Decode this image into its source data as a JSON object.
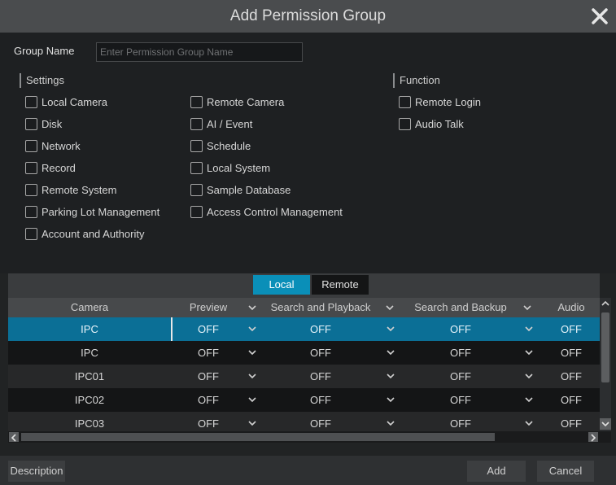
{
  "dialog": {
    "title": "Add Permission Group"
  },
  "group_name": {
    "label": "Group Name",
    "placeholder": "Enter Permission Group Name",
    "value": ""
  },
  "settings": {
    "title": "Settings",
    "col1": [
      "Local Camera",
      "Disk",
      "Network",
      "Record",
      "Remote System",
      "Parking Lot Management",
      "Account and Authority"
    ],
    "col2": [
      "Remote Camera",
      "AI / Event",
      "Schedule",
      "Local System",
      "Sample Database",
      "Access Control Management"
    ]
  },
  "function": {
    "title": "Function",
    "items": [
      "Remote Login",
      "Audio Talk"
    ]
  },
  "tabs": {
    "local": "Local",
    "remote": "Remote",
    "active": "Local"
  },
  "table": {
    "headers": [
      "Camera",
      "Preview",
      "Search and Playback",
      "Search and Backup",
      "Audio"
    ],
    "rows": [
      {
        "camera": "IPC",
        "preview": "OFF",
        "playback": "OFF",
        "backup": "OFF",
        "audio": "OFF",
        "selected": true
      },
      {
        "camera": "IPC",
        "preview": "OFF",
        "playback": "OFF",
        "backup": "OFF",
        "audio": "OFF"
      },
      {
        "camera": "IPC01",
        "preview": "OFF",
        "playback": "OFF",
        "backup": "OFF",
        "audio": "OFF"
      },
      {
        "camera": "IPC02",
        "preview": "OFF",
        "playback": "OFF",
        "backup": "OFF",
        "audio": "OFF"
      },
      {
        "camera": "IPC03",
        "preview": "OFF",
        "playback": "OFF",
        "backup": "OFF",
        "audio": "OFF"
      }
    ]
  },
  "buttons": {
    "description": "Description",
    "add": "Add",
    "cancel": "Cancel"
  },
  "colors": {
    "accent": "#0a8fb8",
    "row_selected": "#0b6f96",
    "row_a": "#272829",
    "row_b": "#141516"
  }
}
